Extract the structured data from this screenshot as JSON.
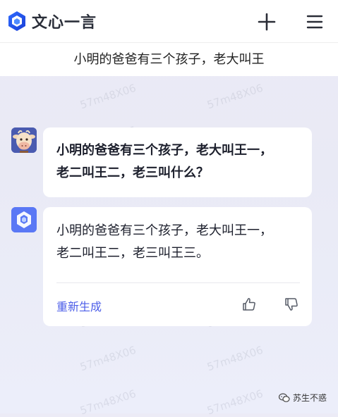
{
  "header": {
    "brand": "文心一言",
    "new_chat_icon": "plus-icon",
    "menu_icon": "hamburger-menu-icon"
  },
  "conversation": {
    "title": "小明的爸爸有三个孩子，老大叫王"
  },
  "messages": [
    {
      "role": "user",
      "avatar_icon": "cow-avatar-icon",
      "lines": [
        "小明的爸爸有三个孩子，老大叫王一，",
        "老二叫王二，老三叫什么？"
      ]
    },
    {
      "role": "assistant",
      "avatar_icon": "ernie-bot-logo-icon",
      "lines": [
        "小明的爸爸有三个孩子，老大叫王一，",
        "老二叫王二，老三叫王三。"
      ],
      "regenerate_label": "重新生成",
      "thumbs_up_icon": "thumbs-up-icon",
      "thumbs_down_icon": "thumbs-down-icon"
    }
  ],
  "watermark": "57m48X06",
  "source_tag": "苏生不惑",
  "colors": {
    "accent": "#4c5ee8",
    "background": "#ecebf6",
    "card": "#ffffff"
  }
}
